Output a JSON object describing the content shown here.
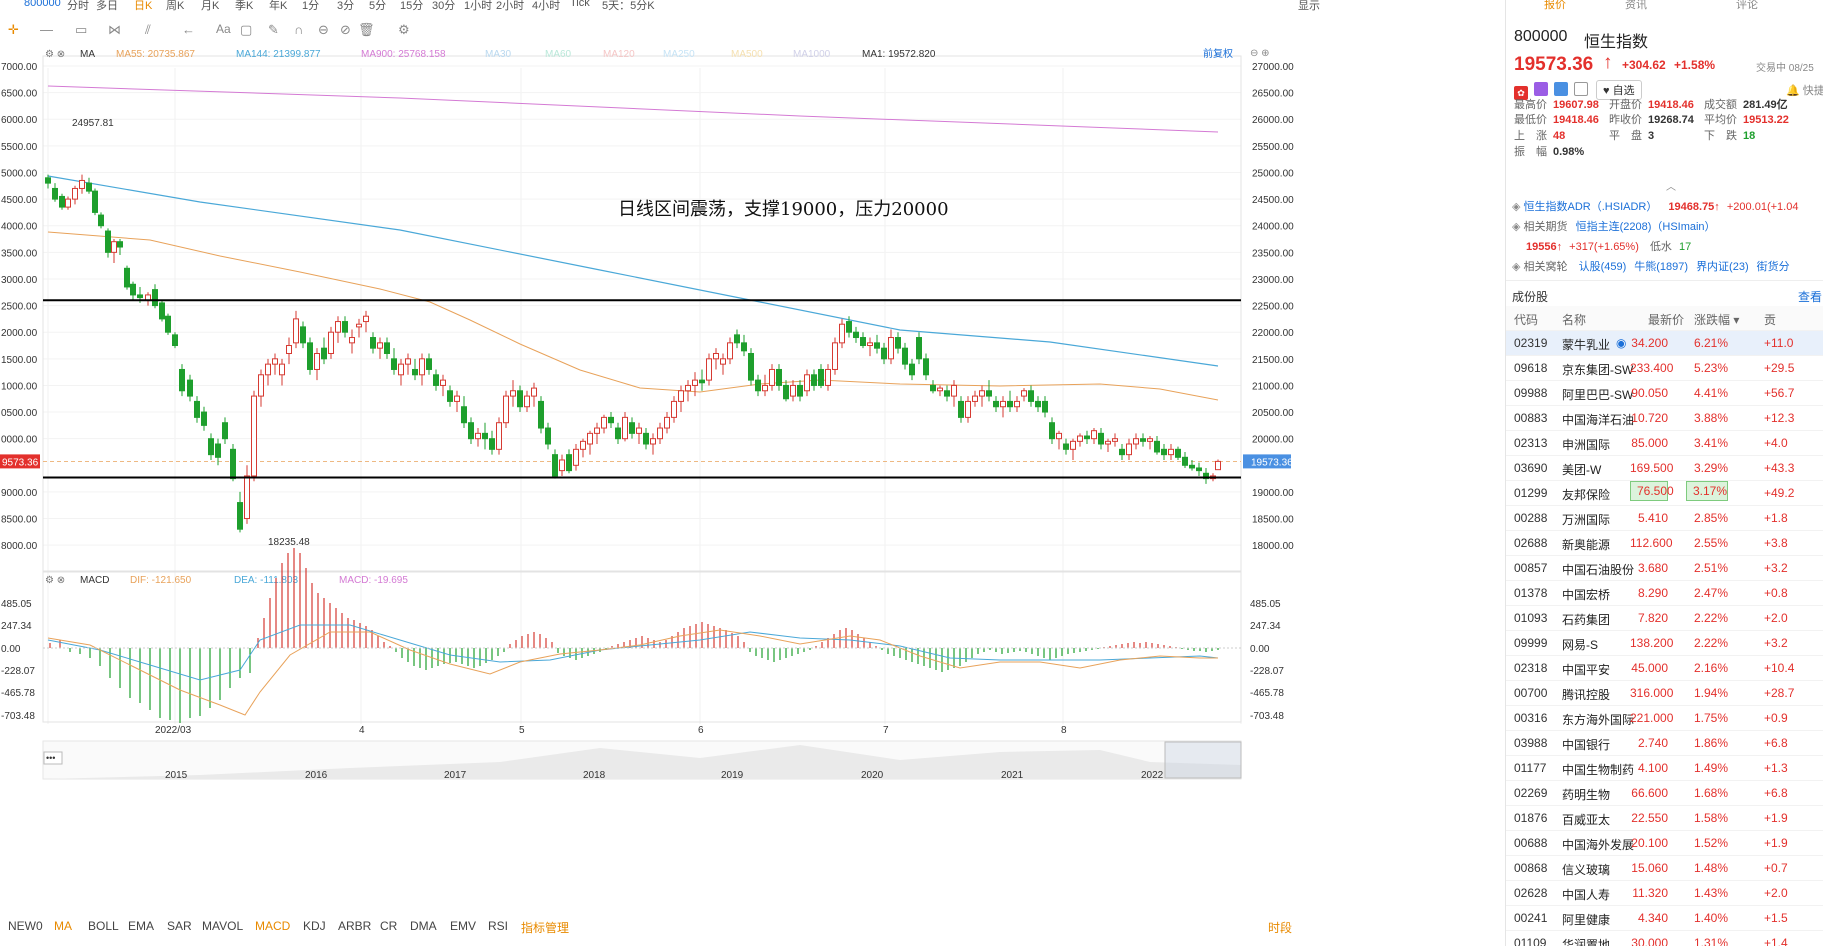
{
  "top_bar": {
    "code": "800000",
    "tabs": [
      "分时",
      "多日",
      "日K",
      "周K",
      "月K",
      "季K",
      "年K",
      "1分",
      "3分",
      "5分",
      "15分",
      "30分",
      "1小时",
      "2小时",
      "4小时",
      "Tick",
      "5天：5分K"
    ],
    "active_tab": "日K",
    "right": [
      "显示"
    ]
  },
  "toolbar": {
    "icons": [
      "crosshair-icon",
      "line-icon",
      "rect-icon",
      "fib-icon",
      "channel-icon",
      "arrow-icon",
      "text-icon",
      "note-icon",
      "pen-icon",
      "magnet-icon",
      "lock-icon",
      "eye-icon",
      "trash-icon",
      "settings-icon"
    ],
    "aa": "Aa"
  },
  "ma_legend": {
    "label": "MA",
    "items": [
      {
        "text": "MA55: 20735.867",
        "color": "#e8a25a"
      },
      {
        "text": "MA144: 21399.877",
        "color": "#4aa8d8"
      },
      {
        "text": "MA900: 25768.158",
        "color": "#d47ad4"
      },
      {
        "text": "MA30",
        "color": "#b9d8ef"
      },
      {
        "text": "MA60",
        "color": "#b9e8d9"
      },
      {
        "text": "MA120",
        "color": "#f5c6c6"
      },
      {
        "text": "MA250",
        "color": "#c6e3f5"
      },
      {
        "text": "MA500",
        "color": "#f5e0b0"
      },
      {
        "text": "MA1000",
        "color": "#d0d0e8"
      },
      {
        "text": "MA1: 19572.820",
        "color": "#333"
      }
    ],
    "right_label": "前复权"
  },
  "price_axis": {
    "ticks": [
      "27000.00",
      "26500.00",
      "26000.00",
      "25500.00",
      "25000.00",
      "24500.00",
      "24000.00",
      "23500.00",
      "23000.00",
      "22500.00",
      "22000.00",
      "21500.00",
      "21000.00",
      "20500.00",
      "20000.00",
      "19000.00",
      "18500.00",
      "18000.00"
    ],
    "left_ticks": [
      "7000.00",
      "6500.00",
      "6000.00",
      "5500.00",
      "5000.00",
      "4500.00",
      "4000.00",
      "3500.00",
      "3000.00",
      "2500.00",
      "2000.00",
      "1500.00",
      "1000.00",
      "0500.00",
      "0000.00",
      "9000.00",
      "8500.00",
      "8000.00"
    ],
    "current_left": "9573.36",
    "current_right": "19573.36"
  },
  "annotations": {
    "high": "24957.81",
    "low": "18235.48",
    "comment": "日线区间震荡，支撑19000，压力20000"
  },
  "macd_legend": {
    "label": "MACD",
    "dif": "DIF: -121.650",
    "dea": "DEA: -111.803",
    "macd": "MACD: -19.695"
  },
  "macd_axis": {
    "ticks": [
      "485.05",
      "247.34",
      "0.00",
      "-228.07",
      "-465.78",
      "-703.48"
    ],
    "left_ticks": [
      "485.05",
      "247.34",
      "0.00",
      "-228.07",
      "-465.78",
      "-703.48"
    ]
  },
  "time_axis": {
    "labels": [
      "2022/03",
      "4",
      "5",
      "6",
      "7",
      "8"
    ]
  },
  "navigator": {
    "labels": [
      "2015",
      "2016",
      "2017",
      "2018",
      "2019",
      "2020",
      "2021",
      "2022"
    ],
    "handle": "•••"
  },
  "bottom_tabs": {
    "items": [
      "NEW0",
      "MA",
      "BOLL",
      "EMA",
      "SAR",
      "MAVOL",
      "MACD",
      "KDJ",
      "ARBR",
      "CR",
      "DMA",
      "EMV",
      "RSI",
      "指标管理"
    ],
    "active": [
      "MA",
      "MACD",
      "指标管理"
    ],
    "right": "时段"
  },
  "chart_data": {
    "type": "candlestick",
    "ylim": [
      18000,
      27000
    ],
    "date_range": "2022/02 - 2022/08",
    "levels": {
      "resistance": 22600,
      "support": 19270
    },
    "high": 24957.81,
    "low": 18235.48,
    "last": 19573.36,
    "ma": {
      "MA55": 20735.867,
      "MA144": 21399.877,
      "MA900": 25768.158,
      "MA1": 19572.82
    },
    "macd": {
      "dif": -121.65,
      "dea": -111.803,
      "macd": -19.695,
      "ylim": [
        -703.48,
        485.05
      ]
    }
  },
  "right_panel": {
    "tabs": [
      "报价",
      "资讯",
      "评论"
    ],
    "code": "800000",
    "name": "恒生指数",
    "price": "19573.36",
    "arrow": "↑",
    "change": "+304.62",
    "pct": "+1.58%",
    "status": "交易中 08/25",
    "follow": "自选",
    "quick": "快捷交",
    "stats": [
      {
        "l": "最高价",
        "v": "19607.98",
        "c": "red"
      },
      {
        "l": "开盘价",
        "v": "19418.46",
        "c": "red"
      },
      {
        "l": "成交额",
        "v": "281.49亿",
        "c": "dark"
      },
      {
        "l": "最低价",
        "v": "19418.46",
        "c": "red"
      },
      {
        "l": "昨收价",
        "v": "19268.74",
        "c": "dark"
      },
      {
        "l": "平均价",
        "v": "19513.22",
        "c": "red"
      },
      {
        "l": "上　涨",
        "v": "48",
        "c": "red"
      },
      {
        "l": "平　盘",
        "v": "3",
        "c": "dark"
      },
      {
        "l": "下　跌",
        "v": "18",
        "c": "green"
      },
      {
        "l": "振　幅",
        "v": "0.98%",
        "c": "dark"
      }
    ],
    "adr": {
      "name": "恒生指数ADR（.HSIADR）",
      "price": "19468.75↑",
      "chg": "+200.01(+1.04"
    },
    "futures": {
      "label": "相关期货",
      "name": "恒指主连(2208)（HSImain）",
      "price": "19556↑",
      "chg": "+317(+1.65%)",
      "basis_label": "低水",
      "basis": "17"
    },
    "warrants": {
      "label": "相关窝轮",
      "items": [
        "认股(459)",
        "牛熊(1897)",
        "界内证(23)",
        "街货分"
      ]
    },
    "cons_title": "成份股",
    "cons_more": "查看",
    "col_headers": [
      "代码",
      "名称",
      "最新价",
      "涨跌幅",
      "贡"
    ],
    "rows": [
      [
        "02319",
        "蒙牛乳业",
        "34.200",
        "6.21%",
        "+11.0"
      ],
      [
        "09618",
        "京东集团-SW",
        "233.400",
        "5.23%",
        "+29.5"
      ],
      [
        "09988",
        "阿里巴巴-SW",
        "90.050",
        "4.41%",
        "+56.7"
      ],
      [
        "00883",
        "中国海洋石油",
        "10.720",
        "3.88%",
        "+12.3"
      ],
      [
        "02313",
        "申洲国际",
        "85.000",
        "3.41%",
        "+4.0"
      ],
      [
        "03690",
        "美团-W",
        "169.500",
        "3.29%",
        "+43.3"
      ],
      [
        "01299",
        "友邦保险",
        "76.500",
        "3.17%",
        "+49.2"
      ],
      [
        "00288",
        "万洲国际",
        "5.410",
        "2.85%",
        "+1.8"
      ],
      [
        "02688",
        "新奥能源",
        "112.600",
        "2.55%",
        "+3.8"
      ],
      [
        "00857",
        "中国石油股份",
        "3.680",
        "2.51%",
        "+3.2"
      ],
      [
        "01378",
        "中国宏桥",
        "8.290",
        "2.47%",
        "+0.8"
      ],
      [
        "01093",
        "石药集团",
        "7.820",
        "2.22%",
        "+2.0"
      ],
      [
        "09999",
        "网易-S",
        "138.200",
        "2.22%",
        "+3.2"
      ],
      [
        "02318",
        "中国平安",
        "45.000",
        "2.16%",
        "+10.4"
      ],
      [
        "00700",
        "腾讯控股",
        "316.000",
        "1.94%",
        "+28.7"
      ],
      [
        "00316",
        "东方海外国际",
        "221.000",
        "1.75%",
        "+0.9"
      ],
      [
        "03988",
        "中国银行",
        "2.740",
        "1.86%",
        "+6.8"
      ],
      [
        "01177",
        "中国生物制药",
        "4.100",
        "1.49%",
        "+1.3"
      ],
      [
        "02269",
        "药明生物",
        "66.600",
        "1.68%",
        "+6.8"
      ],
      [
        "01876",
        "百威亚太",
        "22.550",
        "1.58%",
        "+1.9"
      ],
      [
        "00688",
        "中国海外发展",
        "20.100",
        "1.52%",
        "+1.9"
      ],
      [
        "00868",
        "信义玻璃",
        "15.060",
        "1.48%",
        "+0.7"
      ],
      [
        "02628",
        "中国人寿",
        "11.320",
        "1.43%",
        "+2.0"
      ],
      [
        "00241",
        "阿里健康",
        "4.340",
        "1.40%",
        "+1.5"
      ],
      [
        "01109",
        "华润置地",
        "30.000",
        "1.31%",
        "+1.4"
      ]
    ]
  }
}
